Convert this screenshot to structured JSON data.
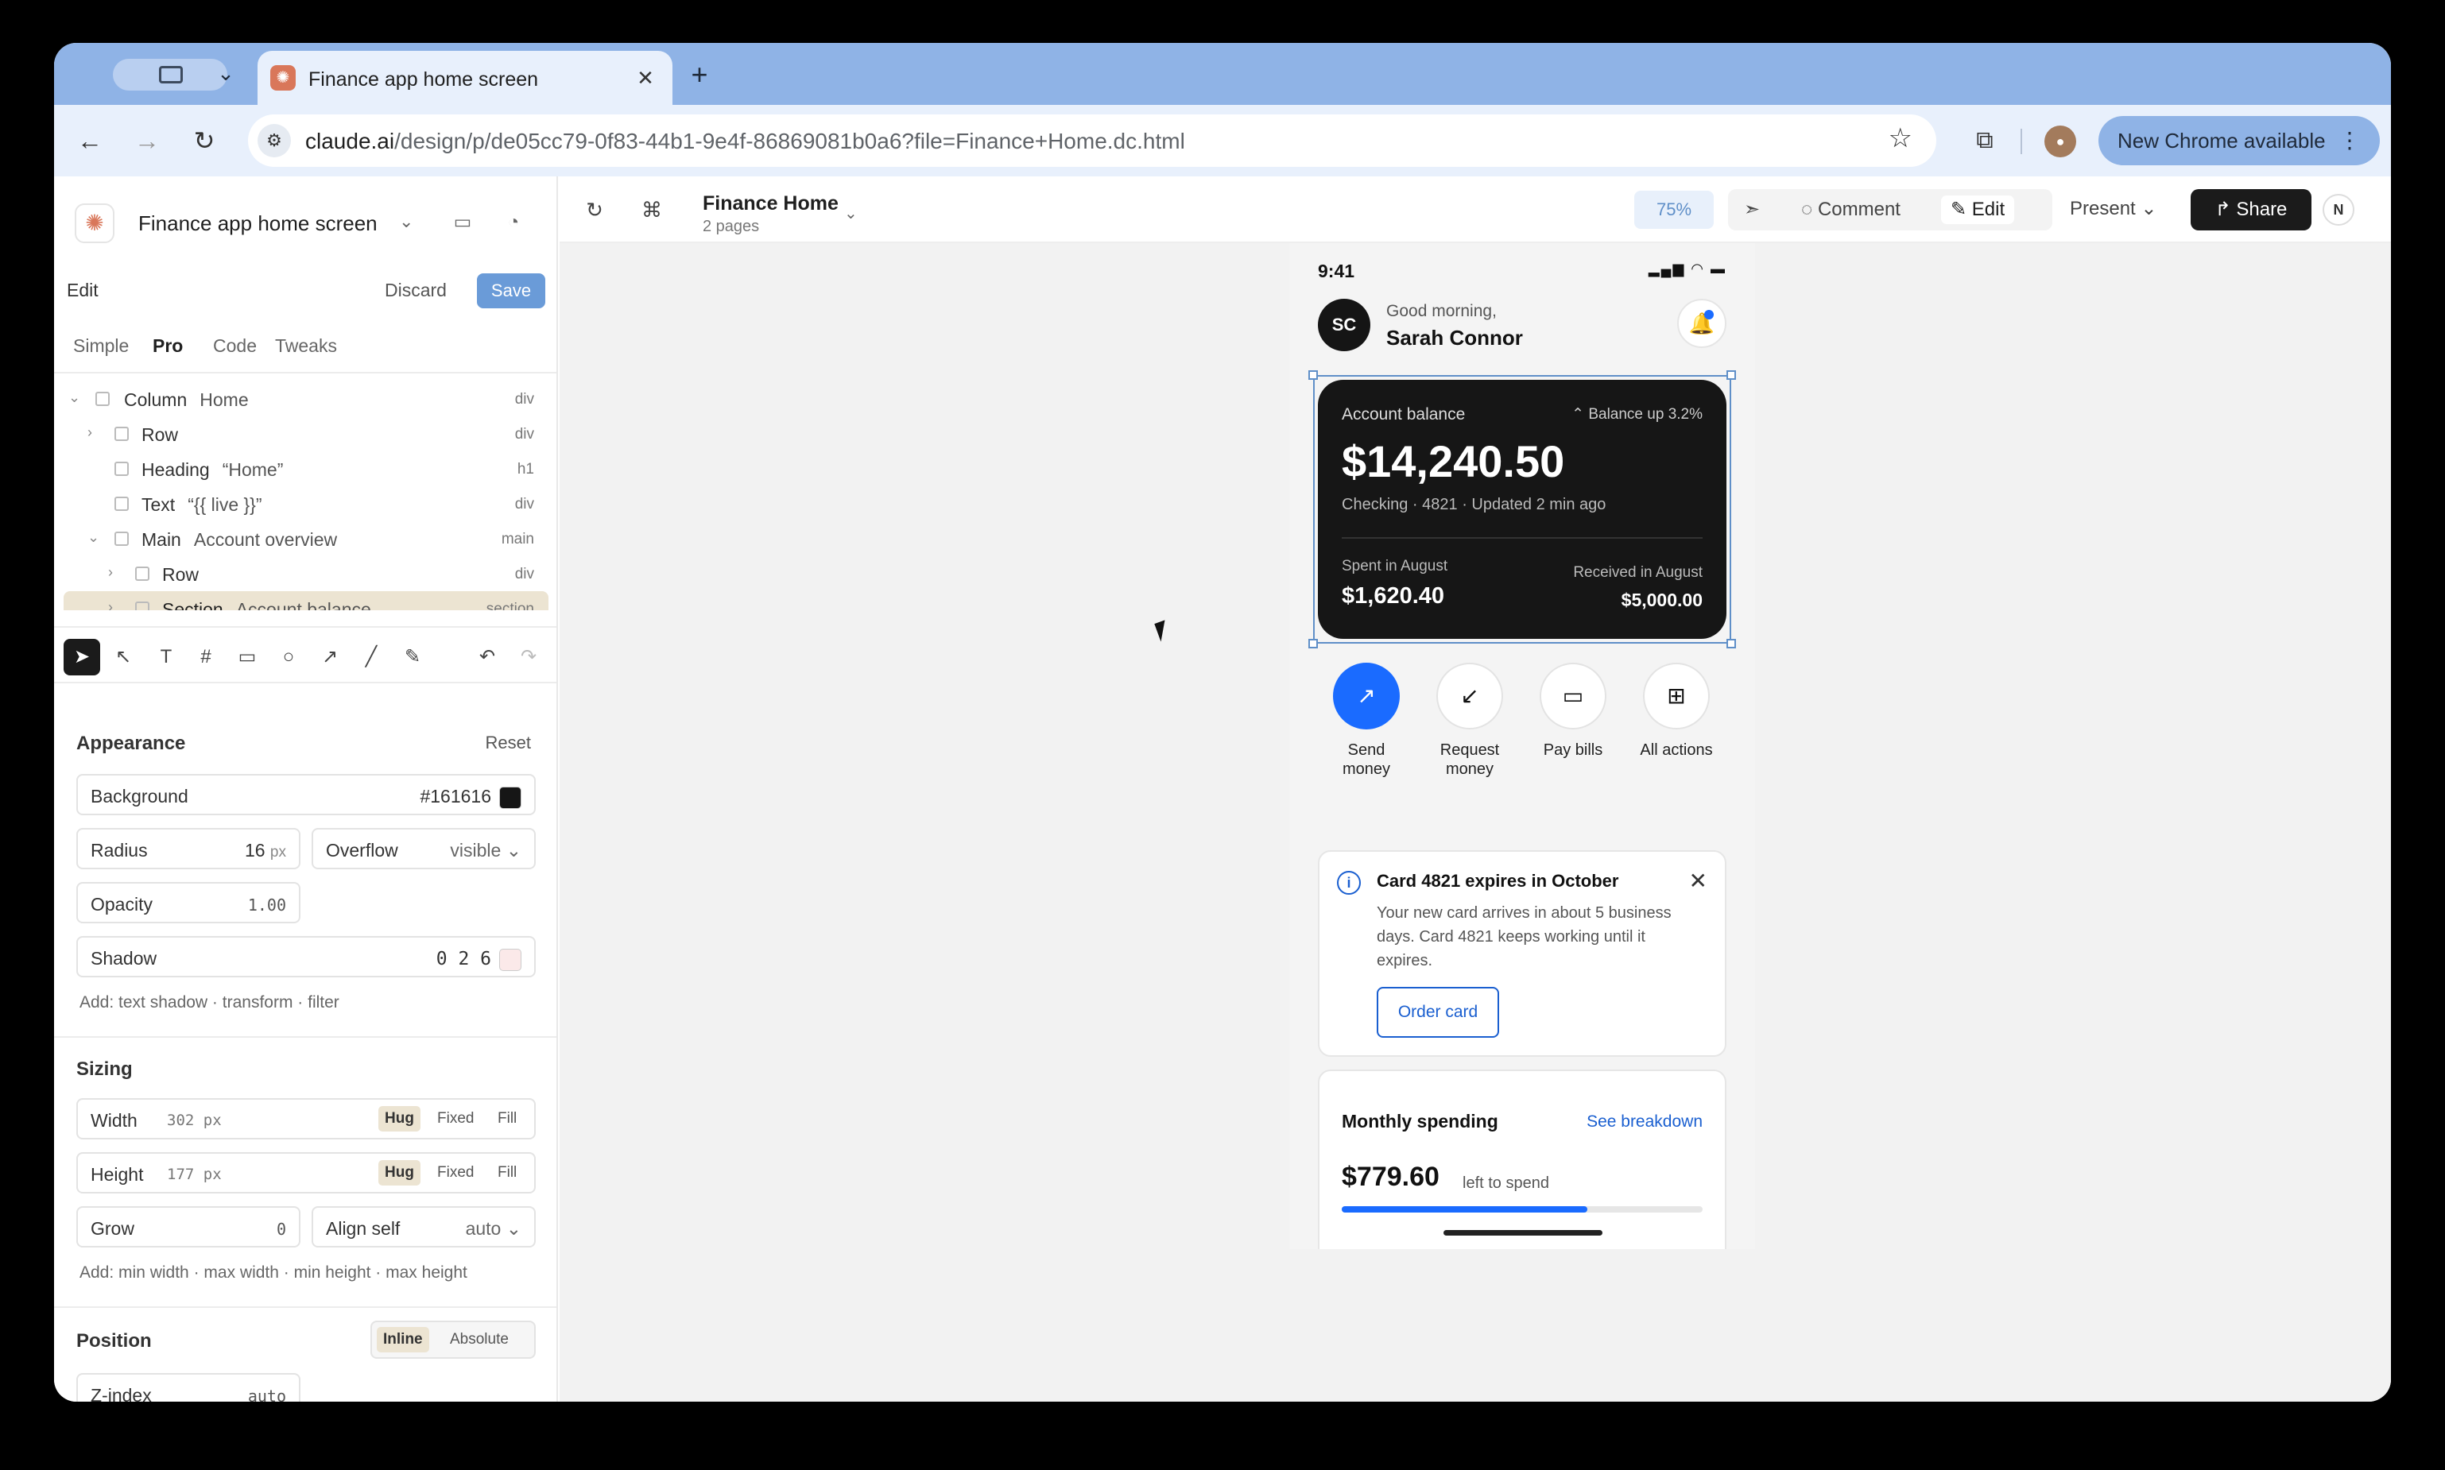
{
  "browser": {
    "tab_title": "Finance app home screen",
    "url_host": "claude.ai",
    "url_path": "/design/p/de05cc79-0f83-44b1-9e4f-86869081b0a6?file=Finance+Home.dc.html",
    "update_button": "New Chrome available"
  },
  "sidebar": {
    "project_title": "Finance app home screen",
    "edit_label": "Edit",
    "discard": "Discard",
    "save": "Save",
    "modes": [
      "Simple",
      "Pro",
      "Code",
      "Tweaks"
    ],
    "layers": [
      {
        "type": "Column",
        "label": "Home",
        "tag": "div"
      },
      {
        "type": "Row",
        "label": "",
        "tag": "div"
      },
      {
        "type": "Heading",
        "label": "“Home”",
        "tag": "h1"
      },
      {
        "type": "Text",
        "label": "“{{ live }}”",
        "tag": "div"
      },
      {
        "type": "Main",
        "label": "Account overview",
        "tag": "main"
      },
      {
        "type": "Row",
        "label": "",
        "tag": "div"
      },
      {
        "type": "Section",
        "label": "Account balance",
        "tag": "section"
      }
    ],
    "appearance": {
      "title": "Appearance",
      "reset": "Reset",
      "background_label": "Background",
      "background_value": "#161616",
      "radius_label": "Radius",
      "radius_value": "16",
      "radius_unit": "px",
      "overflow_label": "Overflow",
      "overflow_value": "visible",
      "opacity_label": "Opacity",
      "opacity_value": "1.00",
      "shadow_label": "Shadow",
      "shadow_value": "0 2 6",
      "add_hint": "Add: text shadow · transform · filter"
    },
    "sizing": {
      "title": "Sizing",
      "width_label": "Width",
      "width_value": "302 px",
      "height_label": "Height",
      "height_value": "177 px",
      "opt_hug": "Hug",
      "opt_fixed": "Fixed",
      "opt_fill": "Fill",
      "grow_label": "Grow",
      "grow_value": "0",
      "align_label": "Align self",
      "align_value": "auto",
      "add_hint": "Add: min width · max width · min height · max height"
    },
    "position": {
      "title": "Position",
      "inline": "Inline",
      "absolute": "Absolute",
      "zindex_label": "Z-index",
      "zindex_value": "auto"
    }
  },
  "canvas": {
    "page_title": "Finance Home",
    "page_count": "2 pages",
    "zoom": "75%",
    "comment": "Comment",
    "edit": "Edit",
    "present": "Present",
    "share": "Share",
    "user_initial": "N"
  },
  "phone": {
    "time": "9:41",
    "avatar": "SC",
    "greeting": "Good morning,",
    "name": "Sarah Connor",
    "balance": {
      "label": "Account balance",
      "trend": "⌃ Balance up 3.2%",
      "amount": "$14,240.50",
      "subtitle": "Checking · 4821 · Updated 2 min ago",
      "spent_label": "Spent in August",
      "spent_value": "$1,620.40",
      "received_label": "Received in August",
      "received_value": "$5,000.00"
    },
    "actions": [
      {
        "label": "Send money"
      },
      {
        "label": "Request money"
      },
      {
        "label": "Pay bills"
      },
      {
        "label": "All actions"
      }
    ],
    "notice": {
      "title": "Card 4821 expires in October",
      "body": "Your new card arrives in about 5 business days. Card 4821 keeps working until it expires.",
      "button": "Order card"
    },
    "spending": {
      "title": "Monthly spending",
      "link": "See breakdown",
      "amount": "$779.60",
      "left": "left to spend",
      "progress": 0.68
    }
  }
}
